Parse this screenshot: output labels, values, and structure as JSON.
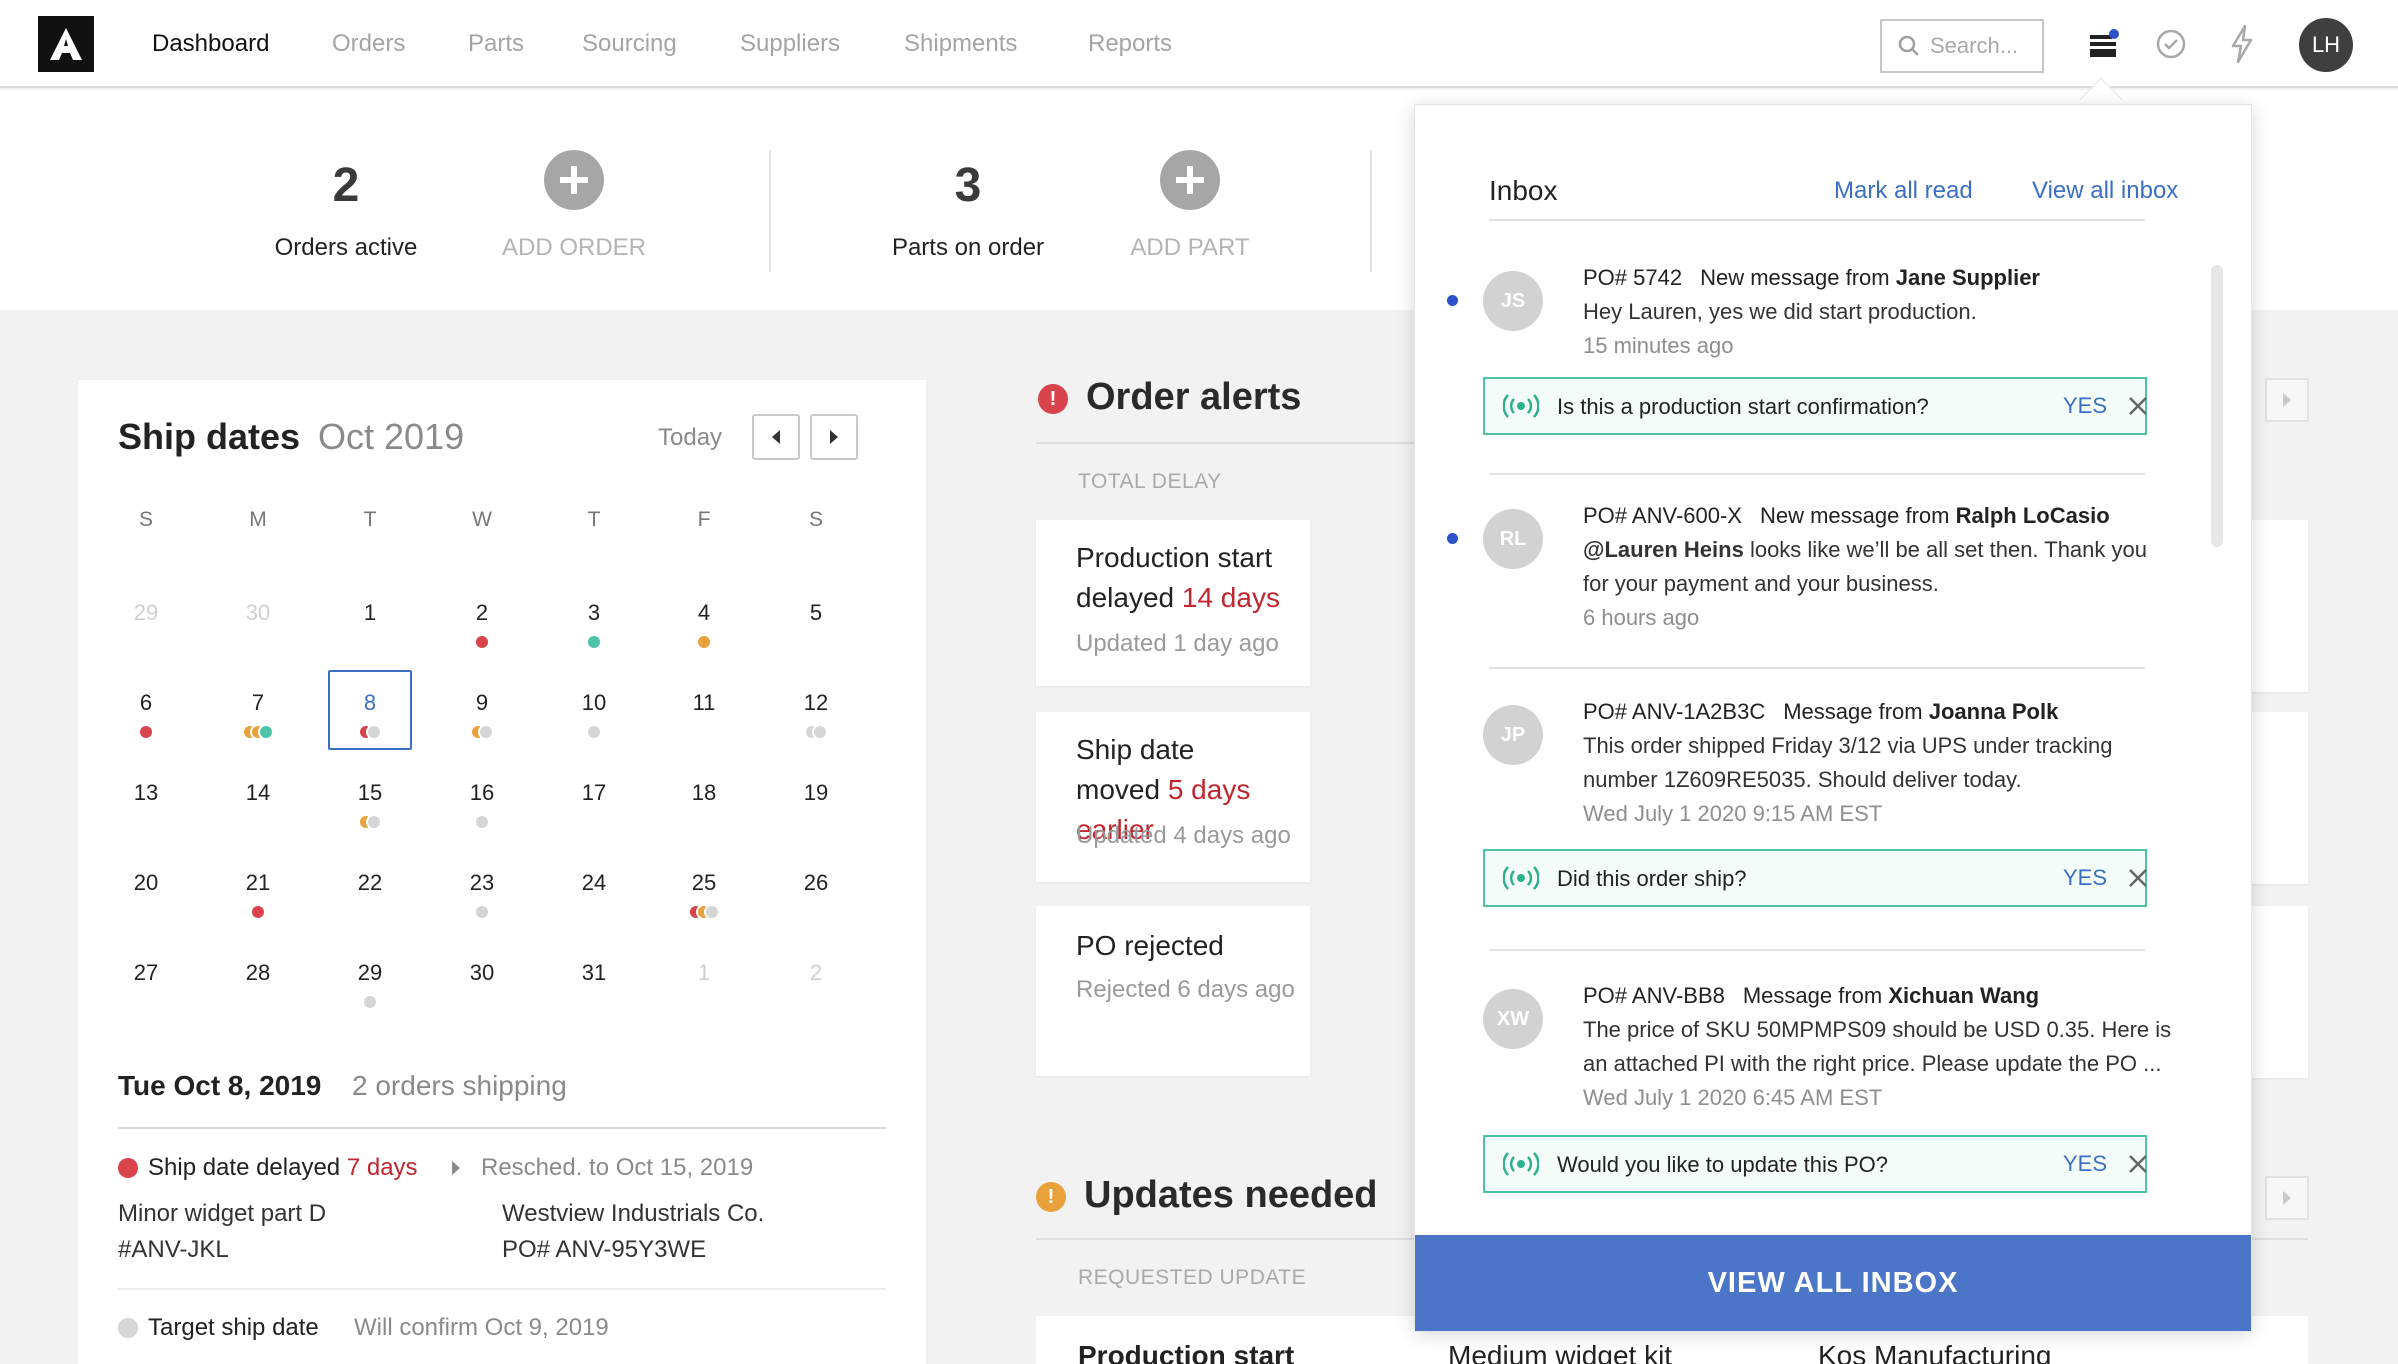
{
  "app": {
    "logo_letter": "A",
    "user_initials": "LH"
  },
  "nav": {
    "items": [
      {
        "label": "Dashboard",
        "active": true
      },
      {
        "label": "Orders"
      },
      {
        "label": "Parts"
      },
      {
        "label": "Sourcing"
      },
      {
        "label": "Suppliers"
      },
      {
        "label": "Shipments"
      },
      {
        "label": "Reports"
      }
    ],
    "search_placeholder": "Search...",
    "icons": [
      "inbox-tray-icon",
      "check-circle-icon",
      "lightning-icon"
    ]
  },
  "stats": {
    "orders_active_count": "2",
    "orders_active_label": "Orders active",
    "add_order_label": "ADD ORDER",
    "parts_count": "3",
    "parts_label": "Parts on order",
    "add_part_label": "ADD PART"
  },
  "calendar": {
    "title": "Ship dates",
    "month": "Oct 2019",
    "today_label": "Today",
    "weekdays": [
      "S",
      "M",
      "T",
      "W",
      "T",
      "F",
      "S"
    ],
    "weeks": [
      [
        {
          "d": "29",
          "muted": true
        },
        {
          "d": "30",
          "muted": true
        },
        {
          "d": "1"
        },
        {
          "d": "2",
          "dots": [
            "red"
          ]
        },
        {
          "d": "3",
          "dots": [
            "teal"
          ]
        },
        {
          "d": "4",
          "dots": [
            "orange"
          ]
        },
        {
          "d": "5"
        }
      ],
      [
        {
          "d": "6",
          "dots": [
            "red"
          ]
        },
        {
          "d": "7",
          "dots": [
            "orange",
            "orange",
            "teal"
          ]
        },
        {
          "d": "8",
          "dots": [
            "red",
            "gray"
          ],
          "selected": true
        },
        {
          "d": "9",
          "dots": [
            "orange",
            "gray"
          ]
        },
        {
          "d": "10",
          "dots": [
            "gray"
          ]
        },
        {
          "d": "11"
        },
        {
          "d": "12",
          "dots": [
            "gray",
            "gray"
          ]
        }
      ],
      [
        {
          "d": "13"
        },
        {
          "d": "14"
        },
        {
          "d": "15",
          "dots": [
            "orange",
            "gray"
          ]
        },
        {
          "d": "16",
          "dots": [
            "gray"
          ]
        },
        {
          "d": "17"
        },
        {
          "d": "18"
        },
        {
          "d": "19"
        }
      ],
      [
        {
          "d": "20"
        },
        {
          "d": "21",
          "dots": [
            "red"
          ]
        },
        {
          "d": "22"
        },
        {
          "d": "23",
          "dots": [
            "gray"
          ]
        },
        {
          "d": "24"
        },
        {
          "d": "25",
          "dots": [
            "red",
            "orange",
            "gray"
          ]
        },
        {
          "d": "26"
        }
      ],
      [
        {
          "d": "27"
        },
        {
          "d": "28"
        },
        {
          "d": "29",
          "dots": [
            "gray"
          ]
        },
        {
          "d": "30"
        },
        {
          "d": "31"
        },
        {
          "d": "1",
          "muted": true
        },
        {
          "d": "2",
          "muted": true
        }
      ]
    ],
    "selected_date": "Tue Oct 8, 2019",
    "selected_count": "2 orders shipping",
    "items": [
      {
        "status_prefix": "Ship date delayed",
        "status_emph": "7 days",
        "resched": "Resched. to Oct 15, 2019",
        "part": "Minor widget part D",
        "part_no": "#ANV-JKL",
        "supplier": "Westview Industrials Co.",
        "po": "PO# ANV-95Y3WE"
      },
      {
        "status_prefix": "Target ship date",
        "resched": "Will confirm Oct 9, 2019"
      }
    ]
  },
  "alerts": {
    "title": "Order alerts",
    "column_header": "TOTAL DELAY",
    "cards": [
      {
        "line1": "Production start",
        "line2_prefix": "delayed",
        "line2_emph": "14 days",
        "sub": "Updated 1 day ago"
      },
      {
        "line1": "Ship date",
        "line2_prefix": "moved",
        "line2_emph": "5 days earlier",
        "sub": "Updated 4 days ago"
      },
      {
        "line1": "PO rejected",
        "sub": "Rejected 6 days ago"
      }
    ]
  },
  "updates": {
    "title": "Updates needed",
    "column_header": "REQUESTED UPDATE",
    "row": {
      "update": "Production start",
      "part": "Medium widget kit",
      "supplier": "Kos Manufacturing"
    }
  },
  "inbox": {
    "title": "Inbox",
    "mark_all_read": "Mark all read",
    "view_all": "View all inbox",
    "footer": "VIEW ALL INBOX",
    "messages": [
      {
        "initials": "JS",
        "unread": true,
        "po": "PO# 5742",
        "kind": "New message from",
        "sender": "Jane Supplier",
        "body": "Hey Lauren, yes we did start production.",
        "time": "15 minutes ago",
        "confirm": "Is this a production start confirmation?"
      },
      {
        "initials": "RL",
        "unread": true,
        "po": "PO# ANV-600-X",
        "kind": "New message from",
        "sender": "Ralph LoCasio",
        "mention": "@Lauren Heins",
        "body": "looks like we’ll be all set then. Thank you for your payment and your business.",
        "time": "6 hours ago"
      },
      {
        "initials": "JP",
        "unread": false,
        "po": "PO# ANV-1A2B3C",
        "kind": "Message from",
        "sender": "Joanna Polk",
        "body": "This order shipped Friday 3/12 via UPS under tracking number 1Z609RE5035. Should deliver today.",
        "time": "Wed July 1 2020 9:15 AM EST",
        "confirm": "Did this order ship?"
      },
      {
        "initials": "XW",
        "unread": false,
        "po": "PO# ANV-BB8",
        "kind": "Message from",
        "sender": "Xichuan Wang",
        "body": "The price of SKU 50MPMPS09 should be USD 0.35. Here is an attached PI with the right price. Please update the PO ...",
        "time": "Wed July 1 2020 6:45 AM EST",
        "confirm": "Would you like to update this PO?"
      }
    ],
    "yes_label": "YES"
  },
  "colors": {
    "accent": "#3b6fc4",
    "red": "#d9434c",
    "orange": "#e9a23b",
    "teal": "#4cc3a6",
    "gray": "#d5d5d5",
    "footer_blue": "#4b76c7",
    "unread_dot": "#2d51c9"
  }
}
